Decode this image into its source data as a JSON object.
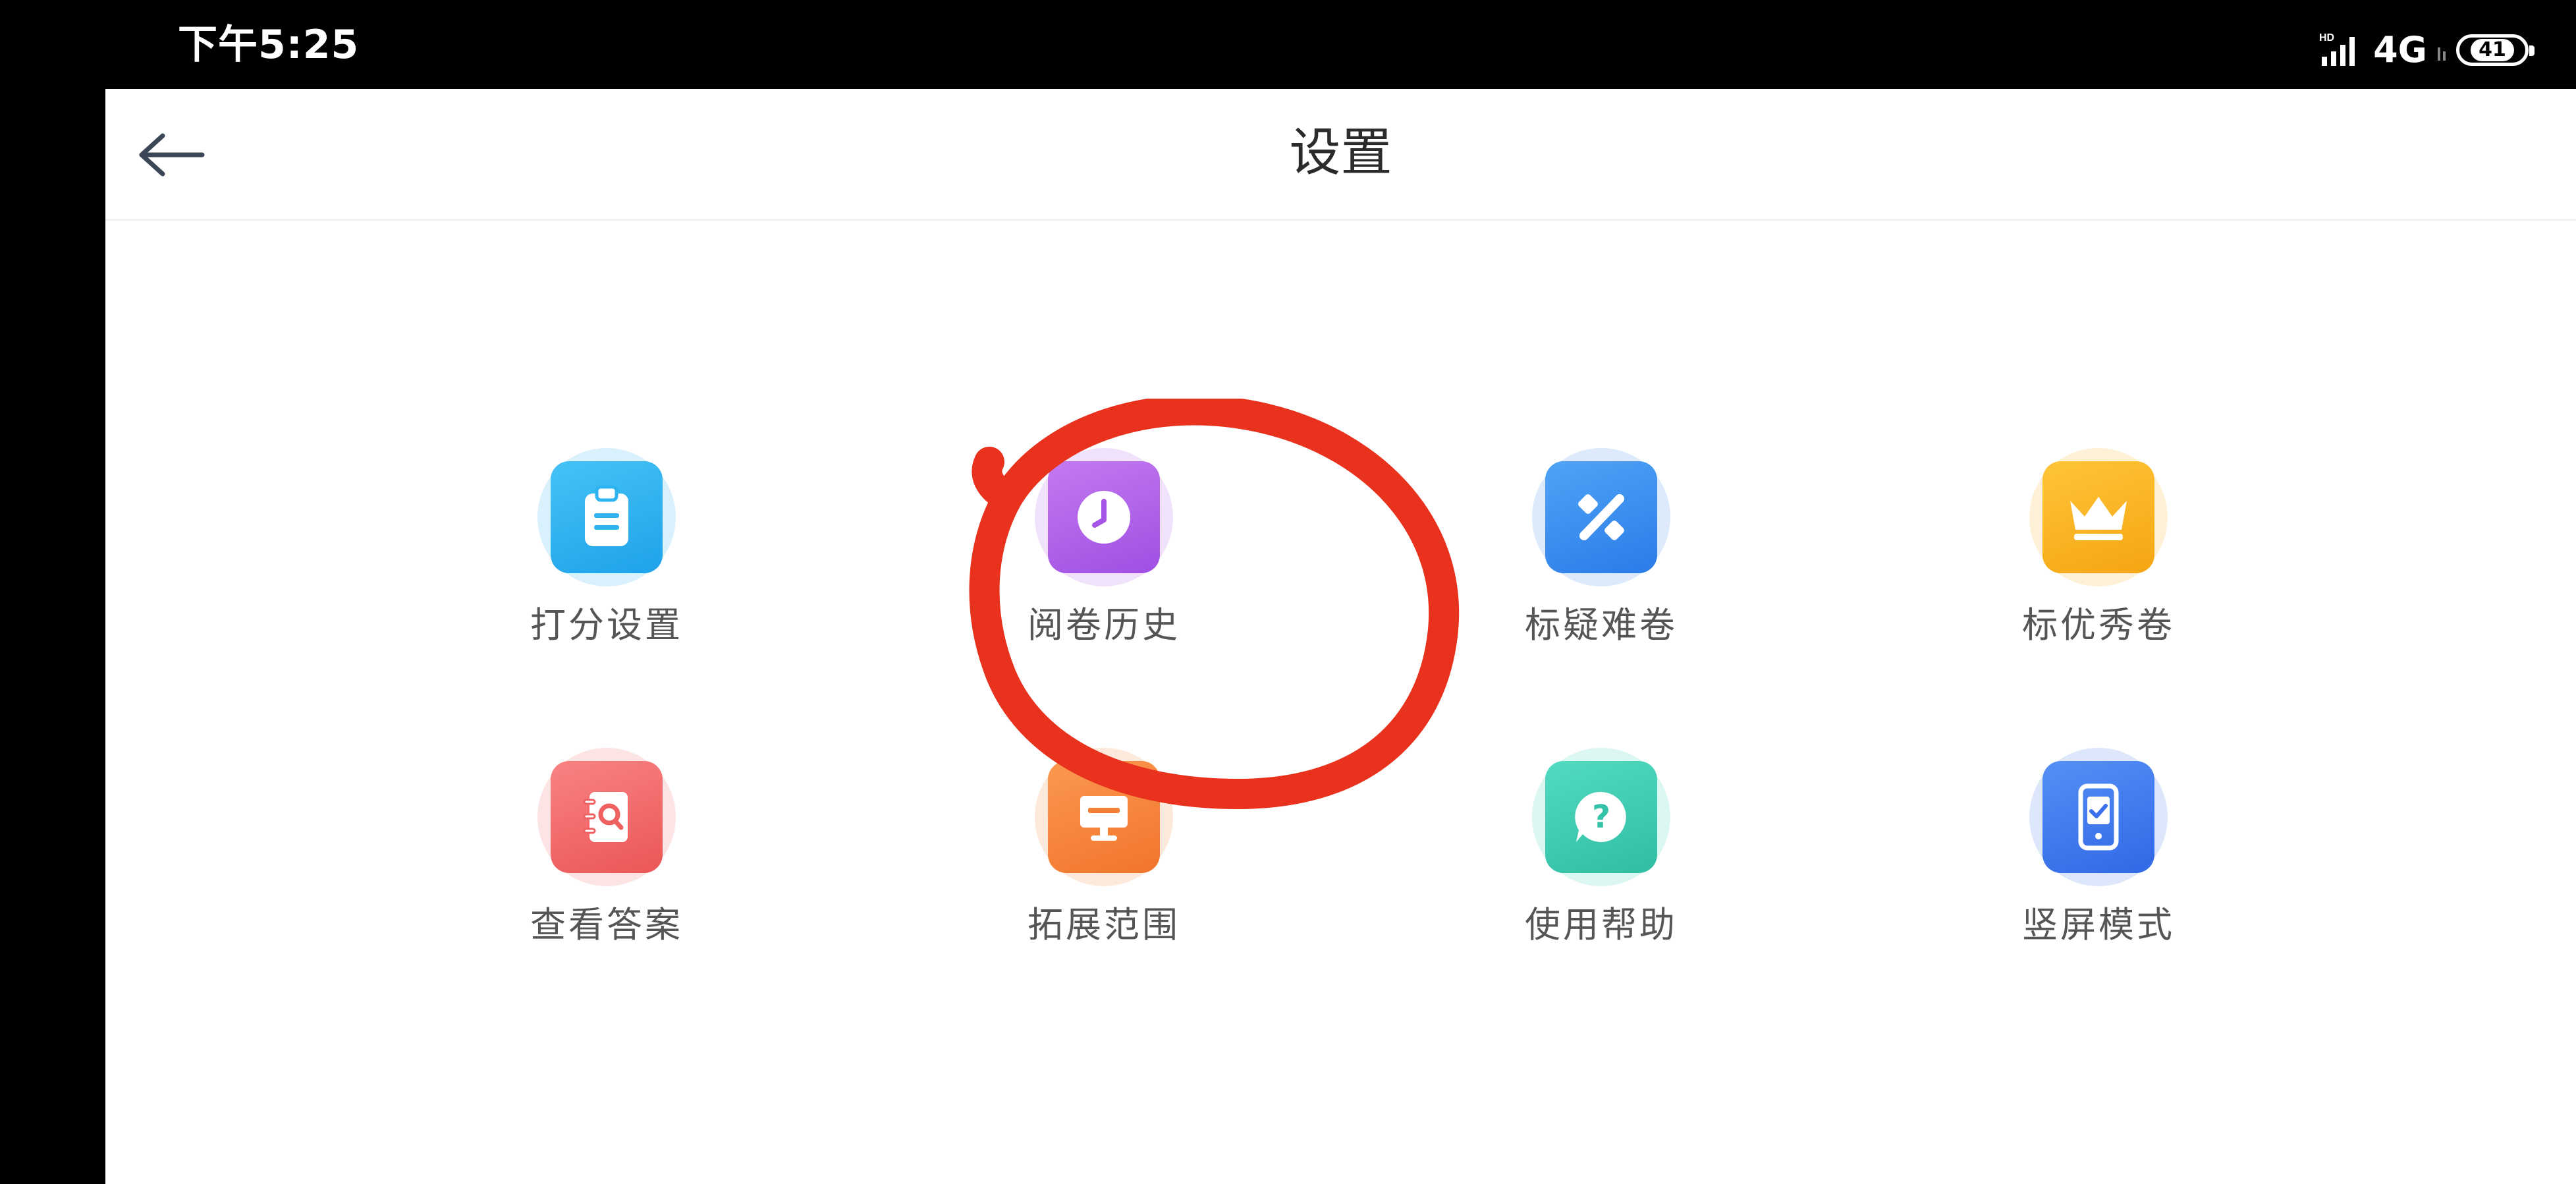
{
  "status_bar": {
    "time": "下午5:25",
    "network": "4G",
    "battery": "41"
  },
  "nav": {
    "title": "设置",
    "back_icon": "back-arrow-icon"
  },
  "tiles": [
    {
      "label": "打分设置",
      "icon": "clipboard-icon",
      "color": "#2fb3f0"
    },
    {
      "label": "阅卷历史",
      "icon": "clock-icon",
      "color": "#b05ee8"
    },
    {
      "label": "标疑难卷",
      "icon": "percent-icon",
      "color": "#3b8cf0"
    },
    {
      "label": "标优秀卷",
      "icon": "crown-icon",
      "color": "#f7b21f"
    },
    {
      "label": "查看答案",
      "icon": "notebook-search-icon",
      "color": "#f26b6b"
    },
    {
      "label": "拓展范围",
      "icon": "monitor-icon",
      "color": "#f5843c"
    },
    {
      "label": "使用帮助",
      "icon": "help-bubble-icon",
      "color": "#3dcbb0"
    },
    {
      "label": "竖屏模式",
      "icon": "phone-check-icon",
      "color": "#3f78ee"
    }
  ],
  "annotation": {
    "color": "#e8321e"
  }
}
